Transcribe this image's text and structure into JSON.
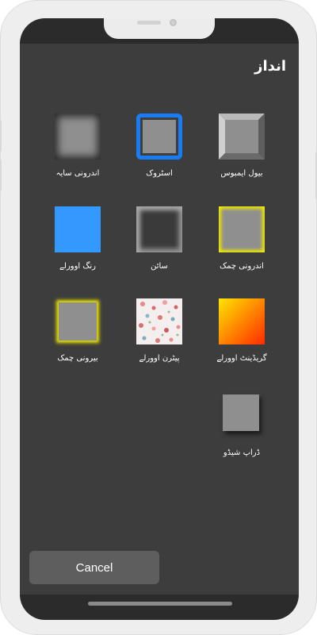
{
  "title": "انداز",
  "styles": [
    {
      "label": "بیول ایمبوس",
      "icon": "bevel-emboss-icon"
    },
    {
      "label": "اسٹروک",
      "icon": "stroke-icon"
    },
    {
      "label": "اندرونی سایہ",
      "icon": "inner-shadow-icon"
    },
    {
      "label": "اندرونی چمک",
      "icon": "inner-glow-icon"
    },
    {
      "label": "سائن",
      "icon": "satin-icon"
    },
    {
      "label": "رنگ اوورلے",
      "icon": "color-overlay-icon"
    },
    {
      "label": "گریڈینٹ اوورلے",
      "icon": "gradient-overlay-icon"
    },
    {
      "label": "پیٹرن اوورلے",
      "icon": "pattern-overlay-icon"
    },
    {
      "label": "بیرونی چمک",
      "icon": "outer-glow-icon"
    },
    {
      "label": "ڈراپ شیڈو",
      "icon": "drop-shadow-icon"
    }
  ],
  "cancel_label": "Cancel",
  "colors": {
    "stroke": "#1a7cf5",
    "overlay": "#3399ff",
    "glow": "#e8e200",
    "gradient_start": "#ffe400",
    "gradient_end": "#ff2a00"
  }
}
